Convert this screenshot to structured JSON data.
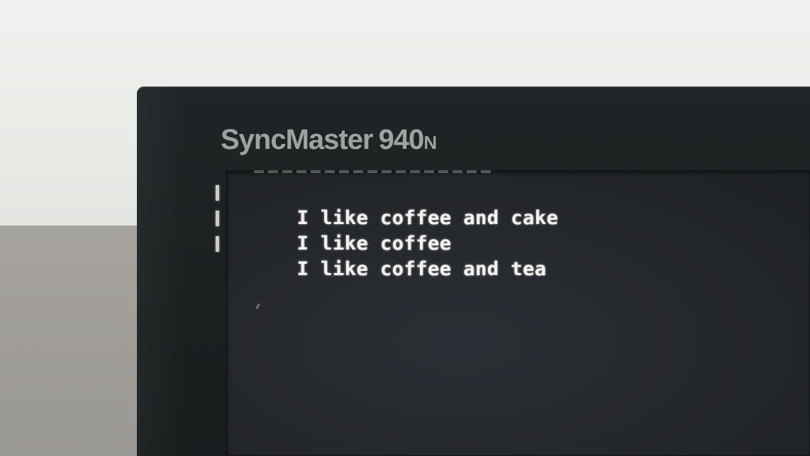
{
  "monitor": {
    "brand": "SyncMaster",
    "model": "940",
    "model_suffix": "N"
  },
  "terminal": {
    "lines": [
      "I like coffee and cake",
      "I like coffee",
      "I like coffee and tea"
    ]
  },
  "colors": {
    "text": "#f4f1ee",
    "screen": "#25282c",
    "bezel": "#1c2122",
    "brand_text": "#9ea2a2"
  }
}
